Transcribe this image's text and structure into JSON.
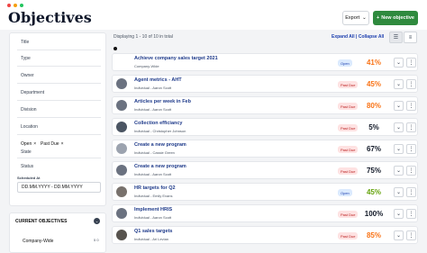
{
  "page": {
    "title": "Objectives"
  },
  "window_dots": [
    "#ef4444",
    "#f59e0b",
    "#22c55e"
  ],
  "header": {
    "export_label": "Export",
    "new_label": "New objective",
    "new_icon": "+",
    "chevron": "⌄"
  },
  "filters": {
    "title": "Title",
    "type": "Type",
    "owner": "Owner",
    "department": "Department",
    "division": "Division",
    "location": "Location",
    "chips": [
      "Open",
      "Past Due"
    ],
    "chip_remove": "×",
    "state": "State",
    "status": "Status",
    "scheduled_at": "Scheduled At",
    "date_range": "DD.MM.YYYY - DD.MM.YYYY"
  },
  "current": {
    "title": "CURRENT OBJECTIVES",
    "toggle": "⌄",
    "item": "Company-Wide",
    "badge": "5",
    "badge2": "0"
  },
  "list": {
    "displaying": "Displaying 1 - 10 of 10 in total",
    "expand": "Expand All",
    "separator": " | ",
    "collapse": "Collapse All"
  },
  "rows": [
    {
      "title": "Achieve company sales target 2021",
      "sub": "Company-Wide",
      "status": "Open",
      "pct": "41%",
      "avatar": "none"
    },
    {
      "title": "Agent metrics - AHT",
      "sub": "Individual - Aaron Scott",
      "status": "Past Due",
      "pct": "45%",
      "avatar": "#6b7280"
    },
    {
      "title": "Articles per week in Feb",
      "sub": "Individual - Aaron Scott",
      "status": "Past Due",
      "pct": "80%",
      "avatar": "#6b7280"
    },
    {
      "title": "Collection efficiancy",
      "sub": "Individual - Christopher Johnson",
      "status": "Past Due",
      "pct": "5%",
      "avatar": "#4b5563"
    },
    {
      "title": "Create a new program",
      "sub": "Individual - Cassie Green",
      "status": "Past Due",
      "pct": "67%",
      "avatar": "#9ca3af"
    },
    {
      "title": "Create a new program",
      "sub": "Individual - Aaron Scott",
      "status": "Past Due",
      "pct": "75%",
      "avatar": "#6b7280"
    },
    {
      "title": "HR targets for Q2",
      "sub": "Individual - Emily Evans",
      "status": "Open",
      "pct": "45%",
      "avatar": "#78716c"
    },
    {
      "title": "Implement HRIS",
      "sub": "Individual - Aaron Scott",
      "status": "Past Due",
      "pct": "100%",
      "avatar": "#6b7280"
    },
    {
      "title": "Q1 sales targets",
      "sub": "Individual - Ari Levian",
      "status": "Past Due",
      "pct": "85%",
      "avatar": "#57534e"
    }
  ],
  "row_actions": {
    "down": "⌄",
    "more": "⋮"
  },
  "colors": {
    "open_bg": "#dbeafe",
    "open_fg": "#1e40af",
    "pastdue_bg": "#fee2e2",
    "pastdue_fg": "#b91c1c",
    "pct_orange": "#f97316",
    "pct_green": "#65a30d",
    "pct_dark": "#111827"
  },
  "icons": {
    "list_view": "☰",
    "grid_view": "≡"
  }
}
